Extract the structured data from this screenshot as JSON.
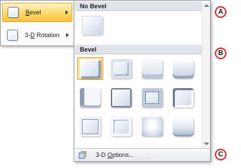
{
  "left_menu": {
    "items": [
      {
        "label_pre": "",
        "label_key": "B",
        "label_post": "evel",
        "active": true
      },
      {
        "label_pre": "3-",
        "label_key": "D",
        "label_post": " Rotation",
        "active": false
      }
    ]
  },
  "gallery": {
    "no_bevel_header": "No Bevel",
    "bevel_header": "Bevel",
    "selected_index": 0,
    "bevel_styles": [
      "b1",
      "b2",
      "b3",
      "b4",
      "b5",
      "b6",
      "b7",
      "b8",
      "b9",
      "b10",
      "b11",
      "b12"
    ]
  },
  "footer": {
    "label_pre": "3-D ",
    "label_key": "O",
    "label_post": "ptions..."
  },
  "callouts": [
    "A",
    "B",
    "C"
  ],
  "colors": {
    "accent_selected": "#fde3a7",
    "callout_ring": "#e12b2b"
  }
}
